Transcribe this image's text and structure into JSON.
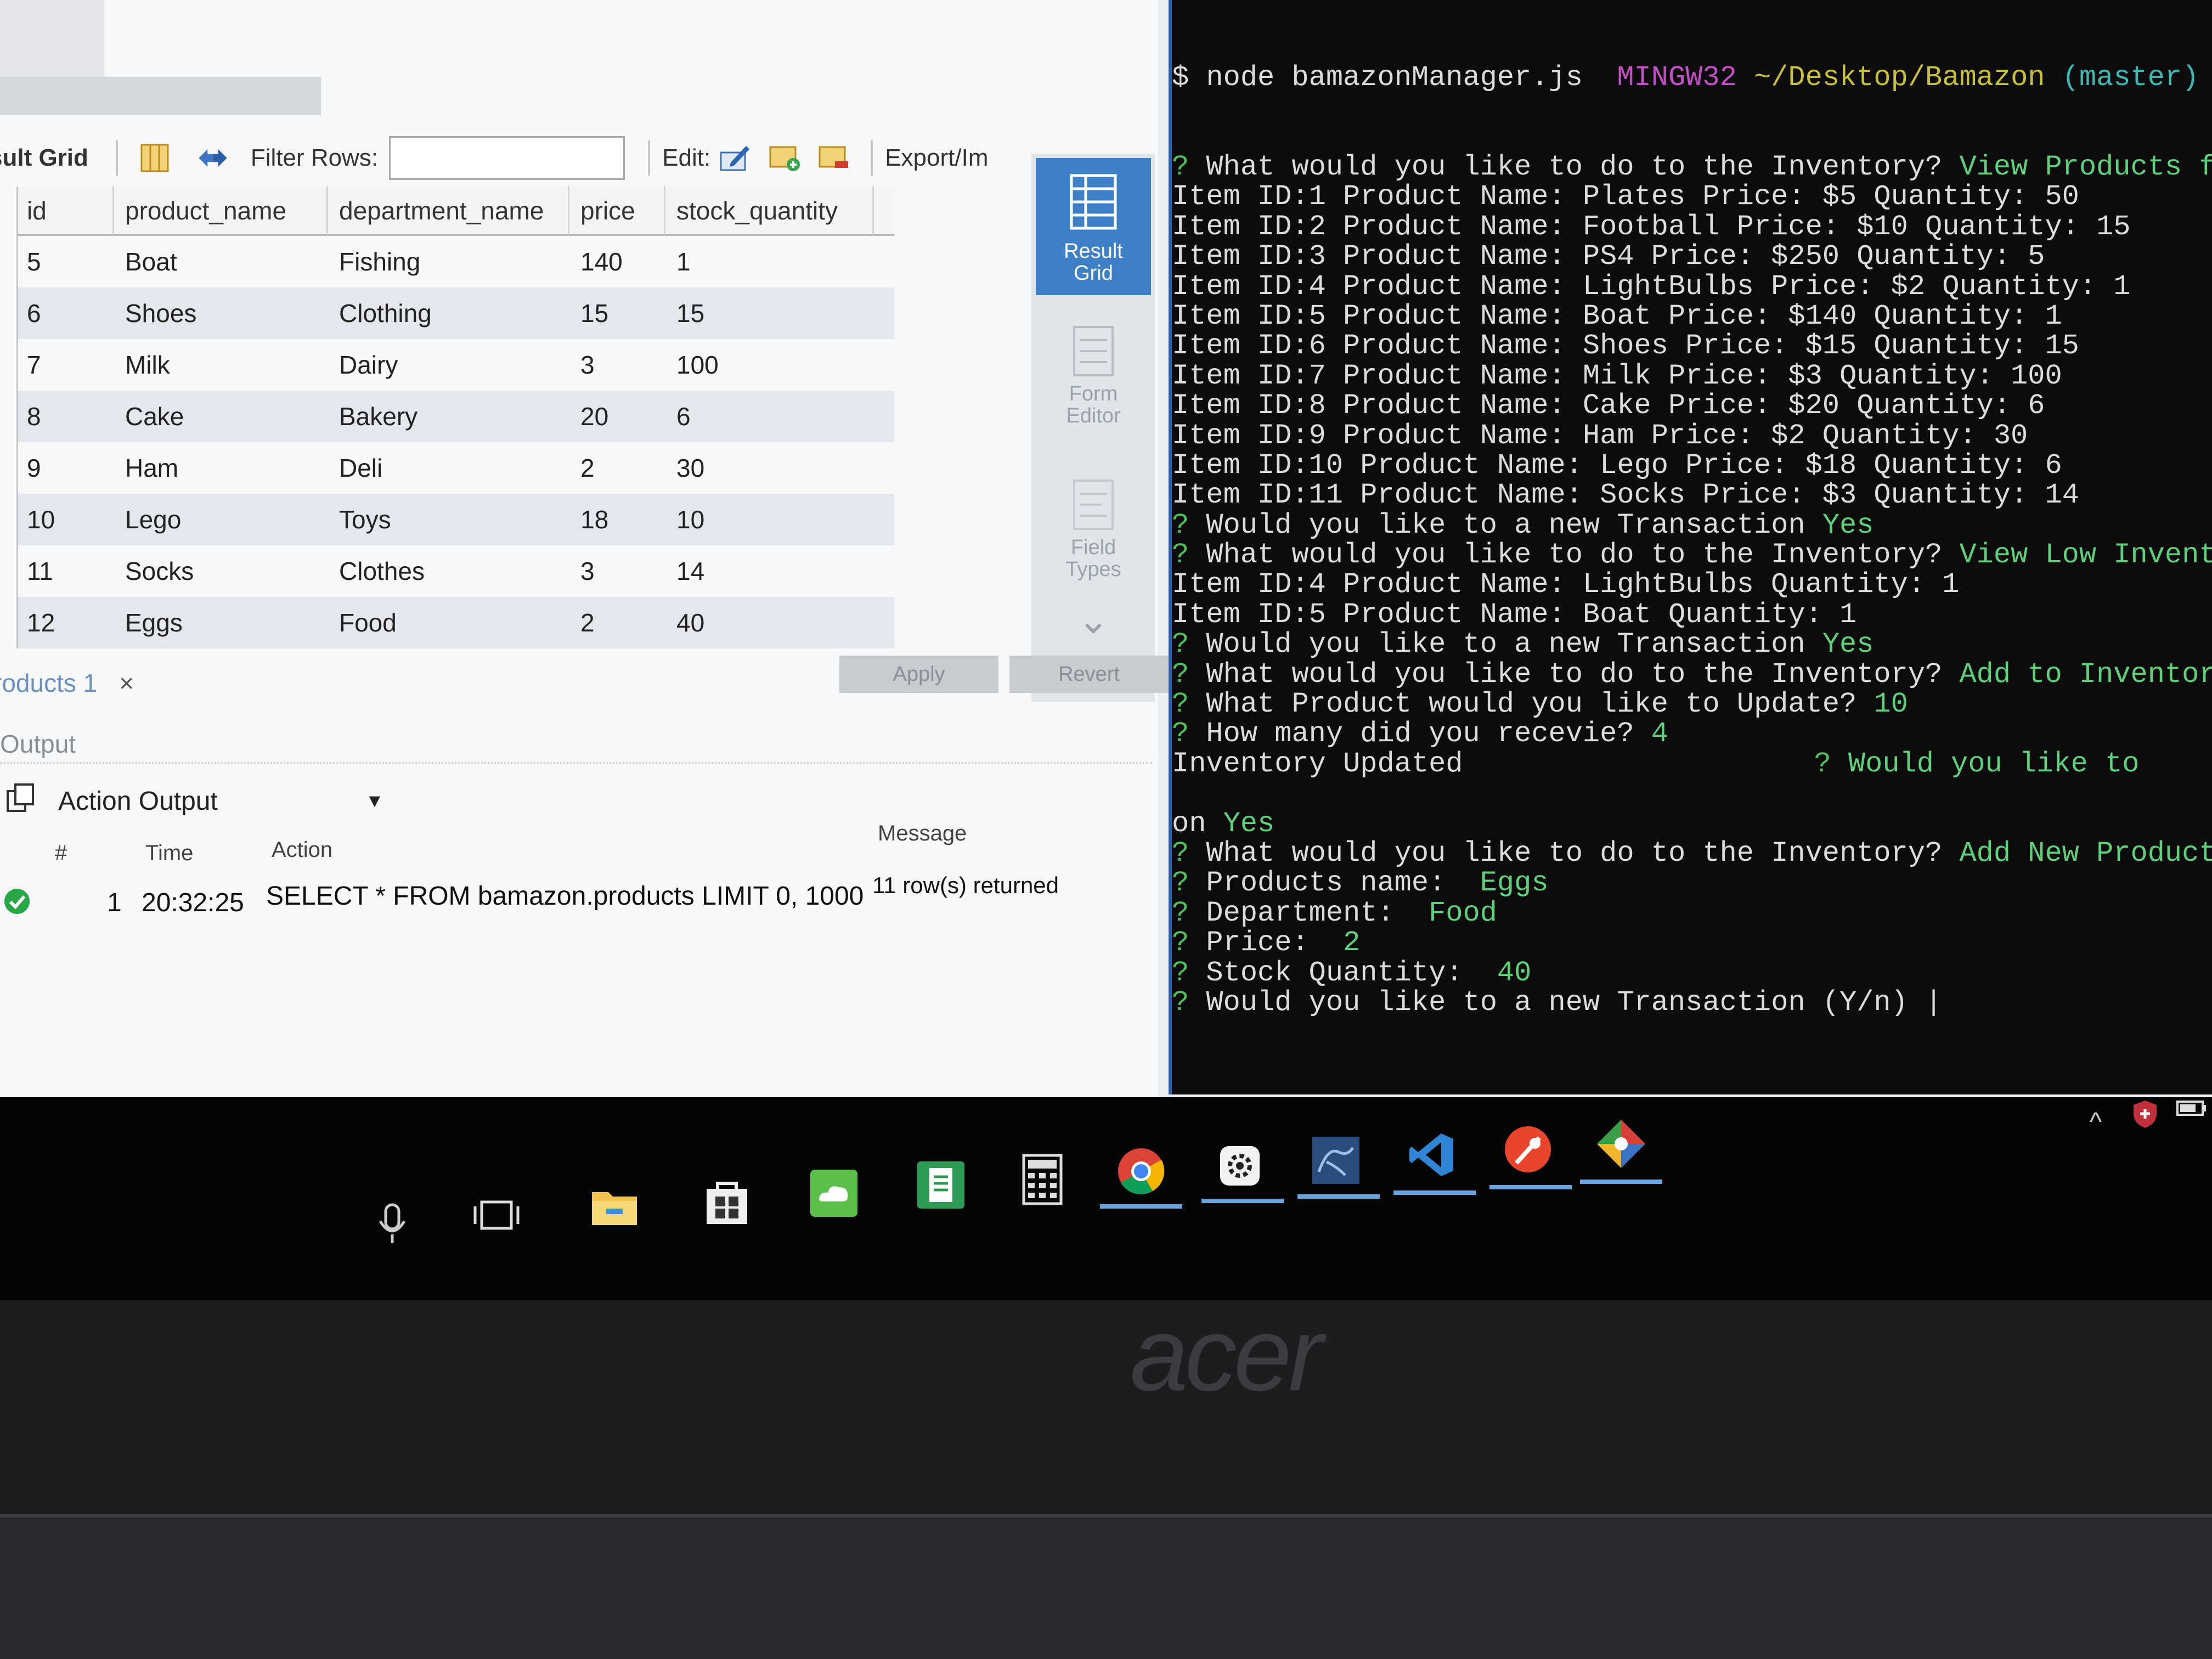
{
  "workbench": {
    "toolbar": {
      "result_grid_label": "sult Grid",
      "filter_label": "Filter Rows:",
      "filter_value": "",
      "edit_label": "Edit:",
      "export_label": "Export/Im"
    },
    "side_panel": {
      "result_grid": "Result Grid",
      "form_editor": "Form Editor",
      "field_types": "Field Types"
    },
    "table": {
      "columns": [
        "id",
        "product_name",
        "department_name",
        "price",
        "stock_quantity"
      ],
      "rows": [
        [
          "5",
          "Boat",
          "Fishing",
          "140",
          "1"
        ],
        [
          "6",
          "Shoes",
          "Clothing",
          "15",
          "15"
        ],
        [
          "7",
          "Milk",
          "Dairy",
          "3",
          "100"
        ],
        [
          "8",
          "Cake",
          "Bakery",
          "20",
          "6"
        ],
        [
          "9",
          "Ham",
          "Deli",
          "2",
          "30"
        ],
        [
          "10",
          "Lego",
          "Toys",
          "18",
          "10"
        ],
        [
          "11",
          "Socks",
          "Clothes",
          "3",
          "14"
        ],
        [
          "12",
          "Eggs",
          "Food",
          "2",
          "40"
        ]
      ]
    },
    "tab": {
      "label": "roducts 1",
      "close": "×"
    },
    "buttons": {
      "apply": "Apply",
      "revert": "Revert"
    },
    "output": {
      "title": "Output",
      "selector": "Action Output",
      "headers": {
        "num": "#",
        "time": "Time",
        "action": "Action",
        "message": "Message"
      },
      "row": {
        "num": "1",
        "time": "20:32:25",
        "action": "SELECT * FROM bamazon.products LIMIT 0, 1000",
        "message": "11 row(s) returned"
      }
    }
  },
  "terminal": {
    "prompt_line": {
      "cmd": "$ node bamazonManager.js",
      "host": "MINGW32",
      "path": "~/Desktop/Bamazon",
      "branch": "(master)"
    },
    "lines": [
      {
        "q": "? ",
        "t": "What would you like to do to the Inventory? ",
        "a": "View Products for"
      },
      {
        "t": "Item ID:1 Product Name: Plates Price: $5 Quantity: 50"
      },
      {
        "t": "Item ID:2 Product Name: Football Price: $10 Quantity: 15"
      },
      {
        "t": "Item ID:3 Product Name: PS4 Price: $250 Quantity: 5"
      },
      {
        "t": "Item ID:4 Product Name: LightBulbs Price: $2 Quantity: 1"
      },
      {
        "t": "Item ID:5 Product Name: Boat Price: $140 Quantity: 1"
      },
      {
        "t": "Item ID:6 Product Name: Shoes Price: $15 Quantity: 15"
      },
      {
        "t": "Item ID:7 Product Name: Milk Price: $3 Quantity: 100"
      },
      {
        "t": "Item ID:8 Product Name: Cake Price: $20 Quantity: 6"
      },
      {
        "t": "Item ID:9 Product Name: Ham Price: $2 Quantity: 30"
      },
      {
        "t": "Item ID:10 Product Name: Lego Price: $18 Quantity: 6"
      },
      {
        "t": "Item ID:11 Product Name: Socks Price: $3 Quantity: 14"
      },
      {
        "q": "? ",
        "t": "Would you like to a new Transaction ",
        "a": "Yes"
      },
      {
        "q": "? ",
        "t": "What would you like to do to the Inventory? ",
        "a": "View Low Inventory"
      },
      {
        "t": "Item ID:4 Product Name: LightBulbs Quantity: 1"
      },
      {
        "t": "Item ID:5 Product Name: Boat Quantity: 1"
      },
      {
        "q": "? ",
        "t": "Would you like to a new Transaction ",
        "a": "Yes"
      },
      {
        "q": "? ",
        "t": "What would you like to do to the Inventory? ",
        "a": "Add to Inventory"
      },
      {
        "q": "? ",
        "t": "What Product would you like to Update? ",
        "a": "10"
      },
      {
        "q": "? ",
        "t": "How many did you recevie? ",
        "a": "4"
      },
      {
        "t": "Inventory Updated",
        "tail_q": "? ",
        "tail": "Would you like to"
      },
      {
        "t": ""
      },
      {
        "t": "on ",
        "a": "Yes"
      },
      {
        "q": "? ",
        "t": "What would you like to do to the Inventory? ",
        "a": "Add New Product"
      },
      {
        "q": "? ",
        "t": "Products name:  ",
        "a": "Eggs"
      },
      {
        "q": "? ",
        "t": "Department:  ",
        "a": "Food"
      },
      {
        "q": "? ",
        "t": "Price:  ",
        "a": "2"
      },
      {
        "q": "? ",
        "t": "Stock Quantity:  ",
        "a": "40"
      },
      {
        "q": "? ",
        "t": "Would you like to a new Transaction (Y/n) ",
        "cursor": "|"
      }
    ]
  },
  "taskbar": {
    "icons": [
      "microphone-icon",
      "task-view-icon",
      "file-explorer-icon",
      "store-icon",
      "cloud-app-icon",
      "notes-app-icon",
      "calculator-icon",
      "chrome-icon",
      "settings-app-icon",
      "mysql-workbench-icon",
      "vscode-icon",
      "paint-app-icon",
      "git-icon"
    ]
  },
  "device": {
    "brand": "acer"
  }
}
